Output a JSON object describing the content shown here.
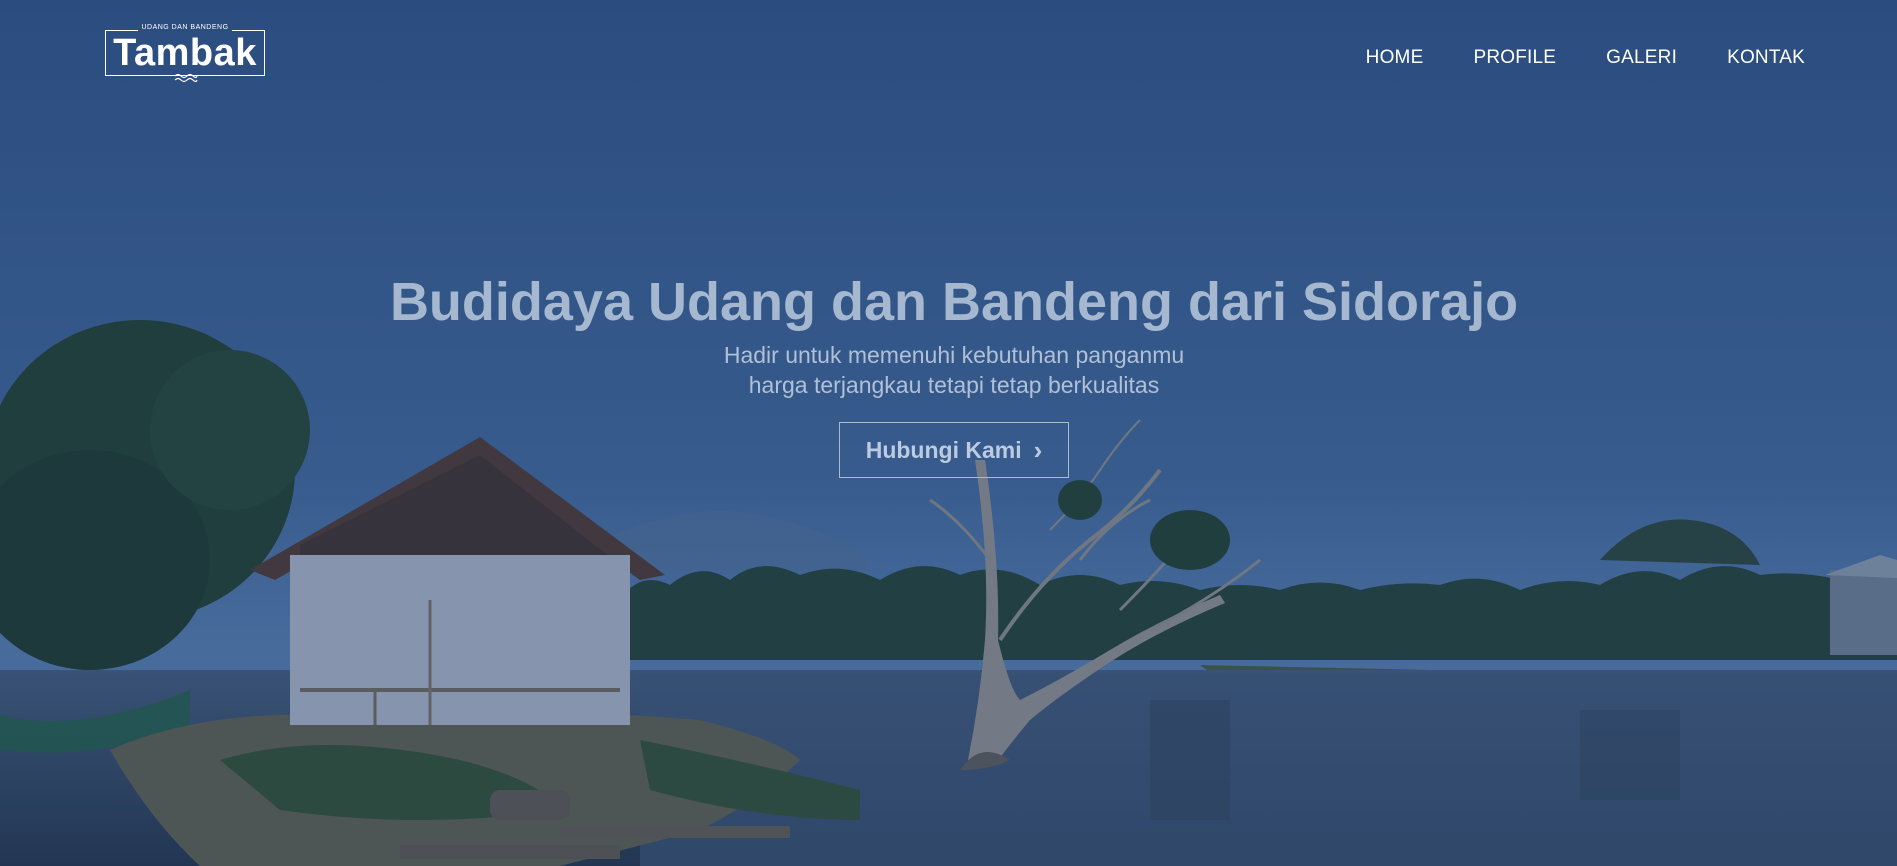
{
  "logo": {
    "tagline": "UDANG DAN BANDENG",
    "name": "Tambak"
  },
  "nav": {
    "items": [
      {
        "label": "HOME"
      },
      {
        "label": "PROFILE"
      },
      {
        "label": "GALERI"
      },
      {
        "label": "KONTAK"
      }
    ]
  },
  "hero": {
    "headline": "Budidaya Udang dan Bandeng dari Sidorajo",
    "subline_1": "Hadir untuk memenuhi kebutuhan panganmu",
    "subline_2": "harga terjangkau tetapi tetap berkualitas",
    "cta_label": "Hubungi Kami",
    "cta_icon": "chevron-right-icon"
  },
  "colors": {
    "overlay": "#2a4a7d",
    "nav_text": "#ffffff",
    "headline": "#a6b8d0"
  }
}
